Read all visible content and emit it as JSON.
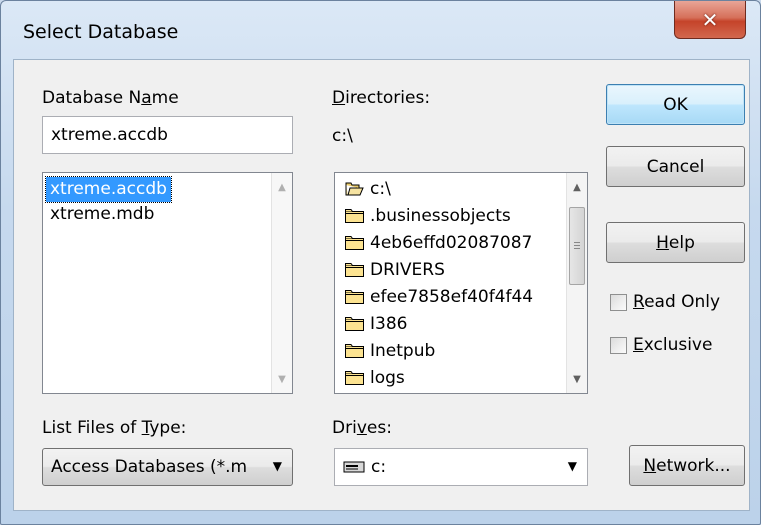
{
  "window": {
    "title": "Select Database",
    "close_glyph": "✕"
  },
  "database_name": {
    "label_pre": "Database N",
    "label_ul": "a",
    "label_post": "me",
    "value": "xtreme.accdb"
  },
  "files": [
    "xtreme.accdb",
    "xtreme.mdb"
  ],
  "selected_file": "xtreme.accdb",
  "directories": {
    "label_ul": "D",
    "label_post": "irectories:",
    "current_path": "c:\\",
    "items": [
      "c:\\",
      ".businessobjects",
      "4eb6effd02087087",
      "DRIVERS",
      "efee7858ef40f4f44",
      "I386",
      "Inetpub",
      "logs"
    ]
  },
  "buttons": {
    "ok": "OK",
    "cancel": "Cancel",
    "help_ul": "H",
    "help_post": "elp",
    "network_ul": "N",
    "network_post": "etwork..."
  },
  "checkboxes": {
    "read_only_ul": "R",
    "read_only_post": "ead Only",
    "read_only_checked": false,
    "exclusive_ul": "E",
    "exclusive_post": "xclusive",
    "exclusive_checked": false
  },
  "file_type": {
    "label_pre": "List Files of ",
    "label_ul": "T",
    "label_post": "ype:",
    "value": "Access Databases (*.m"
  },
  "drives": {
    "label_pre": "Dri",
    "label_ul": "v",
    "label_post": "es:",
    "value": "c:"
  },
  "icons": {
    "folder": "folder-icon",
    "open_folder": "open-folder-icon",
    "drive": "drive-icon"
  }
}
